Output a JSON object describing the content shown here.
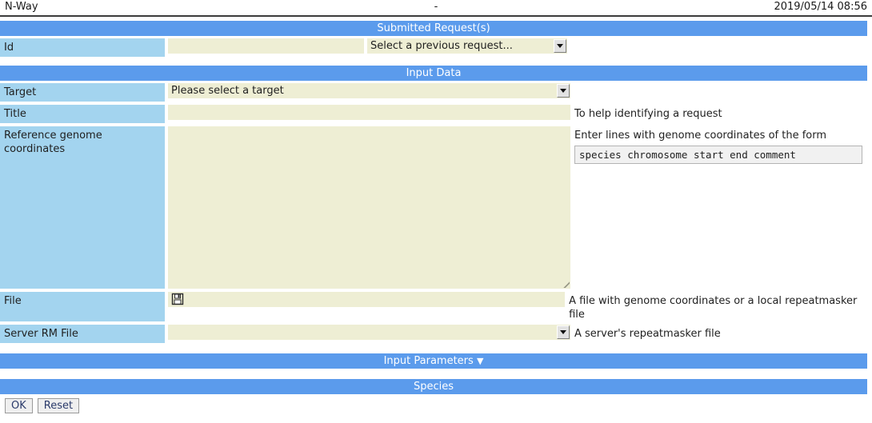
{
  "titlebar": {
    "app_name": "N-Way",
    "center": "-",
    "datetime": "2019/05/14 08:56"
  },
  "sections": {
    "submitted_requests": "Submitted Request(s)",
    "input_data": "Input Data",
    "input_parameters": "Input Parameters",
    "input_parameters_caret": "▼",
    "species": "Species"
  },
  "submitted": {
    "id_label": "Id",
    "id_value": "",
    "id_placeholder": "",
    "previous_request_selected": "Select a previous request...",
    "previous_request_icon": "chevron-down-icon"
  },
  "input_data": {
    "target_label": "Target",
    "target_selected": "Please select a target",
    "title_label": "Title",
    "title_value": "",
    "title_help": "To help identifying a request",
    "coords_label": "Reference genome coordinates",
    "coords_value": "",
    "coords_help": "Enter lines with genome coordinates of the form",
    "coords_format": "species chromosome start end comment",
    "file_label": "File",
    "file_icon": "floppy-disk-icon",
    "file_help": "A file with genome coordinates or a local repeatmasker file",
    "server_rm_label": "Server RM File",
    "server_rm_selected": "",
    "server_rm_help": "A server's repeatmasker file"
  },
  "footer": {
    "ok_label": "OK",
    "reset_label": "Reset"
  },
  "colors": {
    "section_bar": "#5b9bec",
    "label_cell": "#a3d4ef",
    "field_bg": "#eeeed4",
    "button_text": "#2a3a6a"
  }
}
